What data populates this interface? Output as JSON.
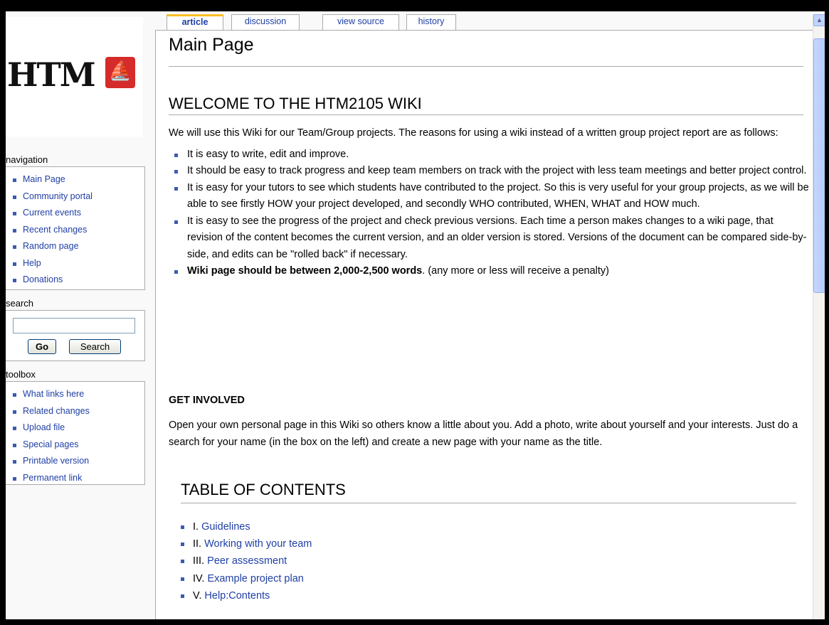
{
  "logo": {
    "text": "HTM",
    "seal_glyph": "⛵",
    "seal_color": "#d52b2b"
  },
  "tabs": [
    {
      "label": "article",
      "active": true
    },
    {
      "label": "discussion"
    },
    {
      "label": "view source"
    },
    {
      "label": "history"
    }
  ],
  "sidebar": {
    "navigation": {
      "heading": "navigation",
      "items": [
        "Main Page",
        "Community portal",
        "Current events",
        "Recent changes",
        "Random page",
        "Help",
        "Donations"
      ]
    },
    "search": {
      "heading": "search",
      "input_value": "",
      "go_label": "Go",
      "search_label": "Search"
    },
    "toolbox": {
      "heading": "toolbox",
      "items": [
        "What links here",
        "Related changes",
        "Upload file",
        "Special pages",
        "Printable version",
        "Permanent link"
      ]
    }
  },
  "content": {
    "title": "Main Page",
    "welcome_heading": "WELCOME TO THE HTM2105 WIKI",
    "intro": "We will use this Wiki for our Team/Group projects. The reasons for using a wiki instead of a written group project report are as follows:",
    "bullets": [
      "It is easy to write, edit and improve.",
      "It should be easy to track progress and keep team members on track with the project with less team meetings and better project control.",
      "It is easy for your tutors to see which students have contributed to the project. So this is very useful for your group projects, as we will be able to see firstly HOW your project developed, and secondly WHO contributed, WHEN, WHAT and HOW much.",
      "It is easy to see the progress of the project and check previous versions. Each time a person makes changes to a wiki page, that revision of the content becomes the current version, and an older version is stored. Versions of the document can be compared side-by-side, and edits can be \"rolled back\" if necessary."
    ],
    "word_limit_bold": "Wiki page should be between 2,000-2,500 words",
    "word_limit_rest": ". (any more or less will receive a penalty)",
    "get_involved_heading": "GET INVOLVED",
    "get_involved_text": "Open your own personal page in this Wiki so others know a little about you. Add a photo, write about yourself and your interests. Just do a search for your name (in the box on the left) and create a new page with your name as the title.",
    "toc_heading": "TABLE OF CONTENTS",
    "toc": [
      {
        "num": "I.",
        "label": "Guidelines"
      },
      {
        "num": "II.",
        "label": "Working with your team"
      },
      {
        "num": "III.",
        "label": "Peer assessment"
      },
      {
        "num": "IV.",
        "label": "Example project plan"
      },
      {
        "num": "V.",
        "label": "Help:Contents"
      }
    ]
  },
  "colors": {
    "link": "#1f3fa5",
    "active_tab_accent": "#fabd23"
  }
}
